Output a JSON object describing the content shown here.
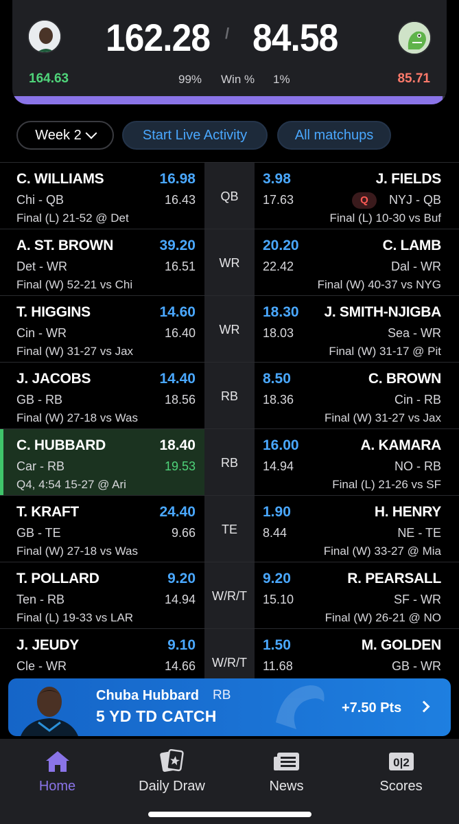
{
  "scoreboard": {
    "left_score": "162.28",
    "right_score": "84.58",
    "left_projected": "164.63",
    "right_projected": "85.71",
    "left_win_pct": "99%",
    "win_label": "Win %",
    "right_win_pct": "1%",
    "left_win_fraction": 0.99
  },
  "filters": {
    "week_label": "Week 2",
    "live_activity_label": "Start Live Activity",
    "all_matchups_label": "All matchups"
  },
  "matchups": [
    {
      "pos": "QB",
      "left": {
        "name": "C. WILLIAMS",
        "pts": "16.98",
        "info": "Chi - QB",
        "proj": "16.43",
        "game": "Final (L) 21-52 @ Det"
      },
      "right": {
        "name": "J. FIELDS",
        "pts": "3.98",
        "info": "NYJ - QB",
        "proj": "17.63",
        "game": "Final (L) 10-30 vs Buf",
        "badge": "Q"
      }
    },
    {
      "pos": "WR",
      "left": {
        "name": "A. ST. BROWN",
        "pts": "39.20",
        "info": "Det - WR",
        "proj": "16.51",
        "game": "Final (W) 52-21 vs Chi"
      },
      "right": {
        "name": "C. LAMB",
        "pts": "20.20",
        "info": "Dal - WR",
        "proj": "22.42",
        "game": "Final (W) 40-37 vs NYG"
      }
    },
    {
      "pos": "WR",
      "left": {
        "name": "T. HIGGINS",
        "pts": "14.60",
        "info": "Cin - WR",
        "proj": "16.40",
        "game": "Final (W) 31-27 vs Jax"
      },
      "right": {
        "name": "J. SMITH-NJIGBA",
        "pts": "18.30",
        "info": "Sea - WR",
        "proj": "18.03",
        "game": "Final (W) 31-17 @ Pit"
      }
    },
    {
      "pos": "RB",
      "left": {
        "name": "J. JACOBS",
        "pts": "14.40",
        "info": "GB - RB",
        "proj": "18.56",
        "game": "Final (W) 27-18 vs Was"
      },
      "right": {
        "name": "C. BROWN",
        "pts": "8.50",
        "info": "Cin - RB",
        "proj": "18.36",
        "game": "Final (W) 31-27 vs Jax"
      }
    },
    {
      "pos": "RB",
      "left": {
        "name": "C. HUBBARD",
        "pts": "18.40",
        "info": "Car - RB",
        "proj": "19.53",
        "game": "Q4, 4:54 15-27 @ Ari"
      },
      "right": {
        "name": "A. KAMARA",
        "pts": "16.00",
        "info": "NO - RB",
        "proj": "14.94",
        "game": "Final (L) 21-26 vs SF"
      }
    },
    {
      "pos": "TE",
      "left": {
        "name": "T. KRAFT",
        "pts": "24.40",
        "info": "GB - TE",
        "proj": "9.66",
        "game": "Final (W) 27-18 vs Was"
      },
      "right": {
        "name": "H. HENRY",
        "pts": "1.90",
        "info": "NE - TE",
        "proj": "8.44",
        "game": "Final (W) 33-27 @ Mia"
      }
    },
    {
      "pos": "W/R/T",
      "left": {
        "name": "T. POLLARD",
        "pts": "9.20",
        "info": "Ten - RB",
        "proj": "14.94",
        "game": "Final (L) 19-33 vs LAR"
      },
      "right": {
        "name": "R. PEARSALL",
        "pts": "9.20",
        "info": "SF - WR",
        "proj": "15.10",
        "game": "Final (W) 26-21 @ NO"
      }
    },
    {
      "pos": "W/R/T",
      "left": {
        "name": "J. JEUDY",
        "pts": "9.10",
        "info": "Cle - WR",
        "proj": "14.66",
        "game": ""
      },
      "right": {
        "name": "M. GOLDEN",
        "pts": "1.50",
        "info": "GB - WR",
        "proj": "11.68",
        "game": ""
      }
    }
  ],
  "banner": {
    "player": "Chuba Hubbard",
    "position": "RB",
    "play": "5 YD TD CATCH",
    "gain": "+7.50 Pts"
  },
  "nav": {
    "home": "Home",
    "daily_draw": "Daily Draw",
    "news": "News",
    "scores": "Scores",
    "scores_icon_text": "0|2"
  },
  "colors": {
    "accent_purple": "#8a74e8",
    "score_blue": "#4aa8ff",
    "positive_green": "#4fd47a",
    "negative_red": "#ff7a6b",
    "banner_blue": "#1a72d4"
  },
  "icons": [
    "player-avatar",
    "opponent-avatar",
    "chevron-down-icon",
    "chevron-right-icon",
    "home-icon",
    "cards-icon",
    "news-icon",
    "scores-icon"
  ]
}
